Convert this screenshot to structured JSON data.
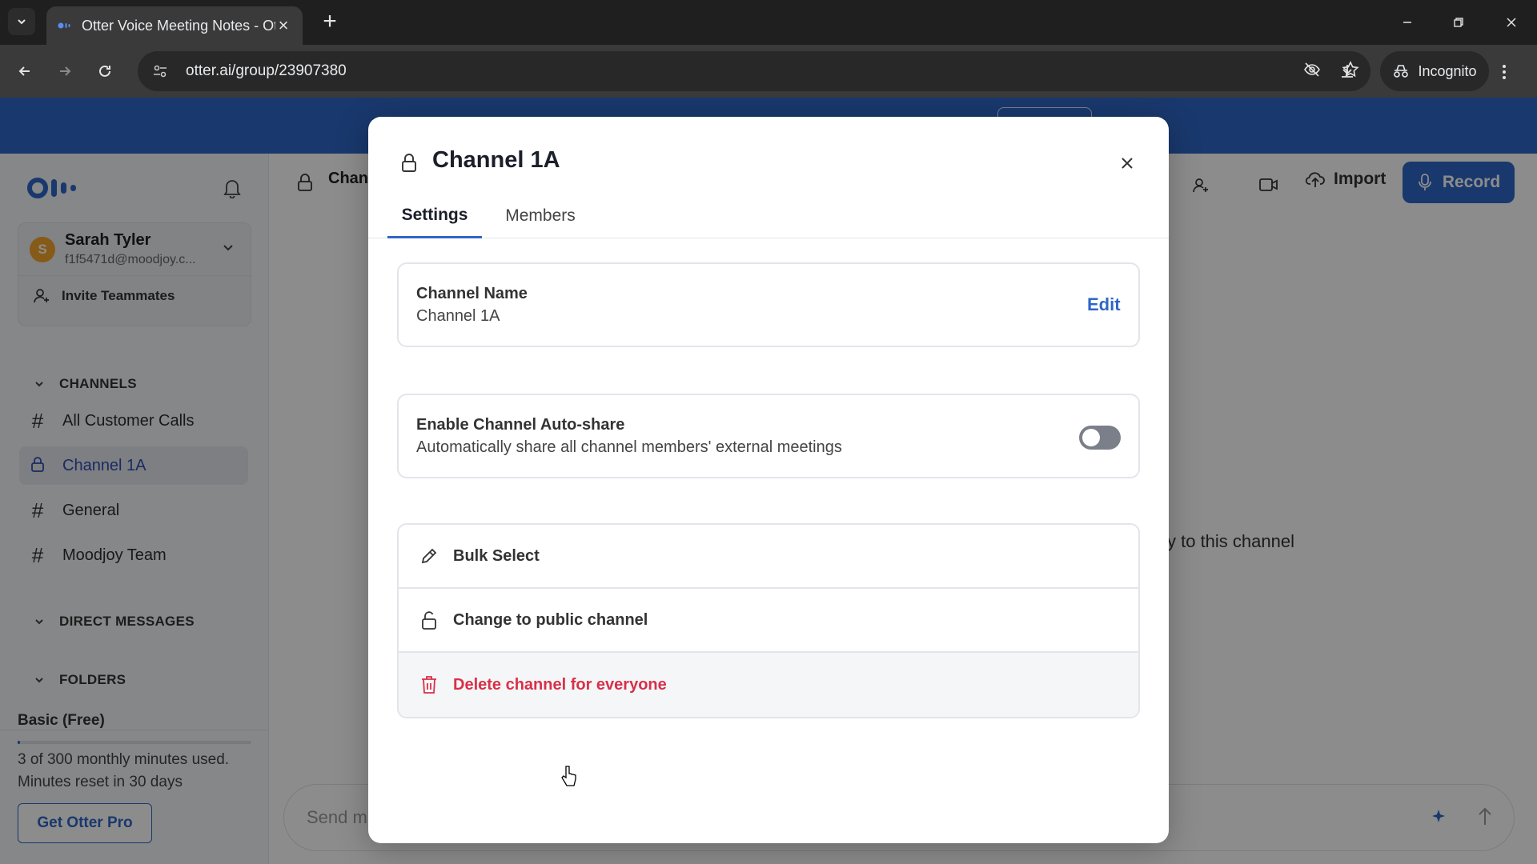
{
  "browser": {
    "tab_title": "Otter Voice Meeting Notes - Ot",
    "url": "otter.ai/group/23907380",
    "incognito_label": "Incognito"
  },
  "sidebar": {
    "user": {
      "initial": "S",
      "name": "Sarah Tyler",
      "email": "f1f5471d@moodjoy.c..."
    },
    "invite_label": "Invite Teammates",
    "channels_header": "CHANNELS",
    "channels": [
      {
        "label": "All Customer Calls",
        "icon": "hash-icon"
      },
      {
        "label": "Channel 1A",
        "icon": "lock-icon"
      },
      {
        "label": "General",
        "icon": "hash-icon"
      },
      {
        "label": "Moodjoy Team",
        "icon": "hash-icon"
      }
    ],
    "direct_messages_header": "DIRECT MESSAGES",
    "folders_header": "FOLDERS",
    "plan": {
      "title": "Basic (Free)",
      "usage_line1": "3 of 300 monthly minutes used.",
      "usage_line2": "Minutes reset in 30 days",
      "usage_fraction": 0.01,
      "cta": "Get Otter Pro"
    }
  },
  "main": {
    "header_title": "Chan",
    "import_label": "Import",
    "record_label": "Record",
    "background_text": "y to this channel",
    "send_placeholder": "Send m"
  },
  "modal": {
    "title": "Channel 1A",
    "tabs": [
      {
        "label": "Settings",
        "active": true
      },
      {
        "label": "Members",
        "active": false
      }
    ],
    "channel_name": {
      "label": "Channel Name",
      "value": "Channel 1A",
      "edit_label": "Edit"
    },
    "auto_share": {
      "label": "Enable Channel Auto-share",
      "description": "Automatically share all channel members' external meetings",
      "enabled": false
    },
    "actions": [
      {
        "label": "Bulk Select",
        "icon": "pencil-icon"
      },
      {
        "label": "Change to public channel",
        "icon": "unlock-icon"
      },
      {
        "label": "Delete channel for everyone",
        "icon": "trash-icon"
      }
    ]
  },
  "colors": {
    "accent": "#2f66c7",
    "danger": "#d93048"
  }
}
